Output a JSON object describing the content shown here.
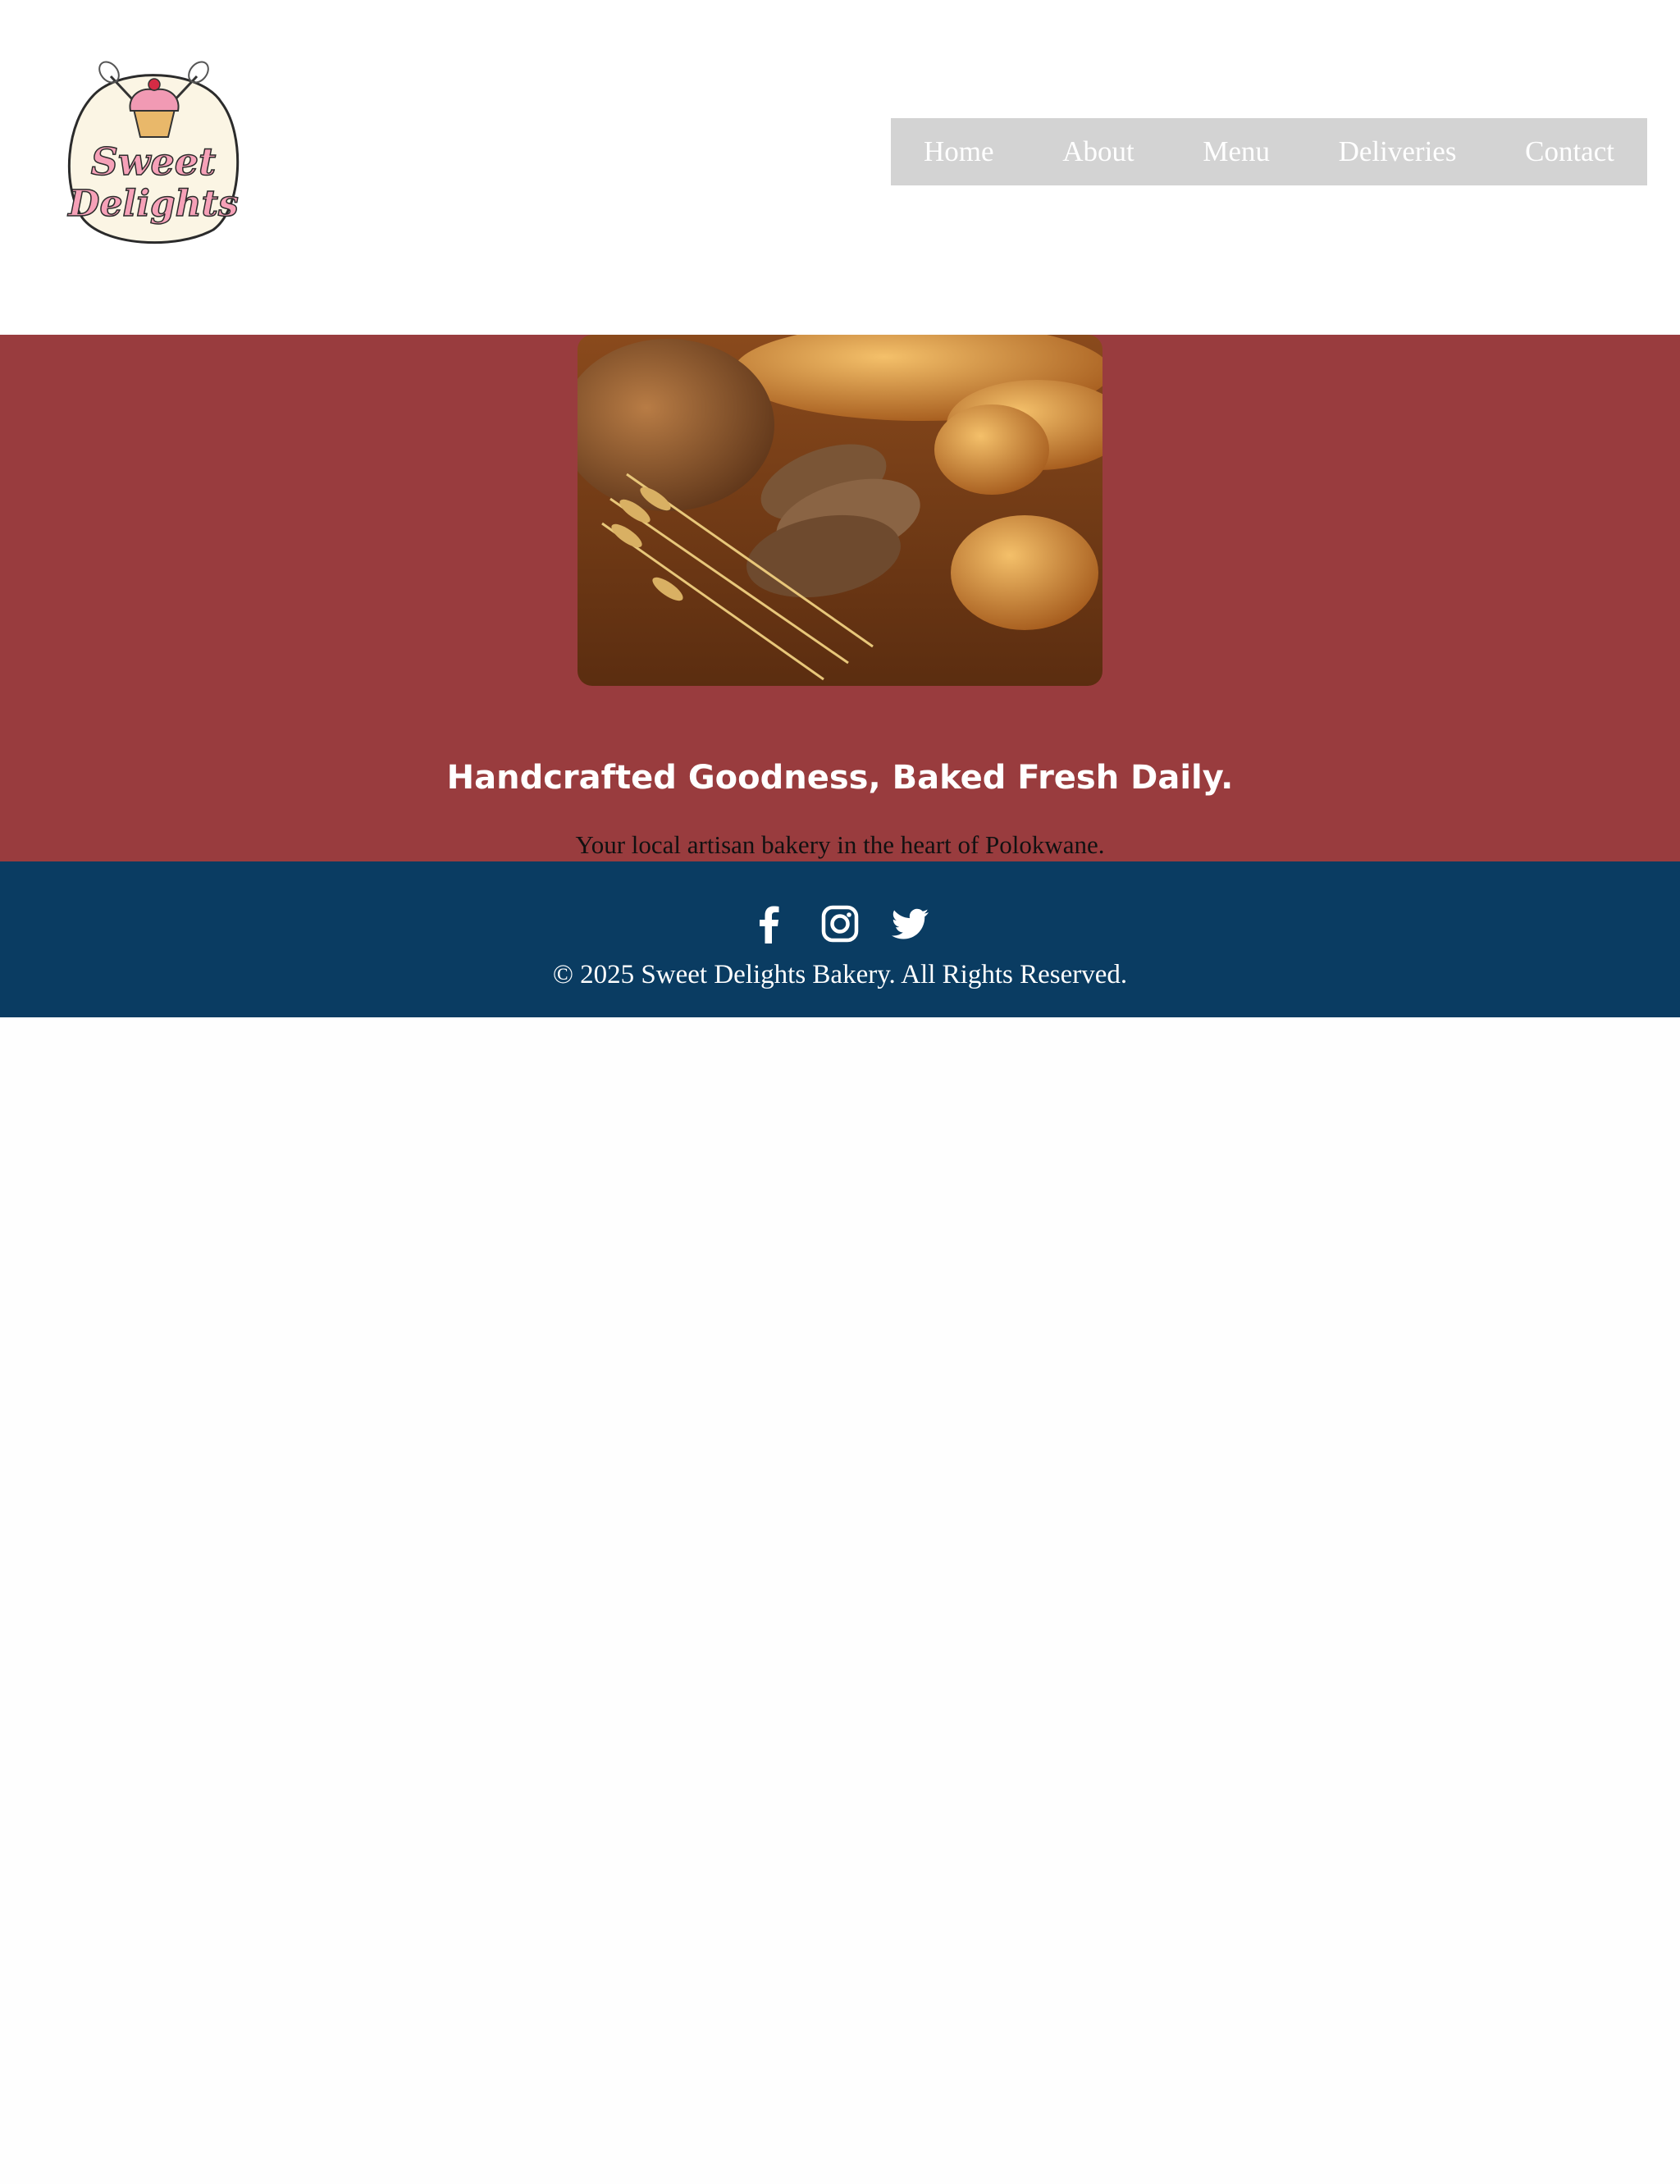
{
  "logo": {
    "line1": "Sweet",
    "line2": "Delights"
  },
  "nav": {
    "items": [
      {
        "label": "Home"
      },
      {
        "label": "About"
      },
      {
        "label": "Menu"
      },
      {
        "label": "Deliveries"
      },
      {
        "label": "Contact"
      }
    ]
  },
  "hero": {
    "title": "Handcrafted Goodness, Baked Fresh Daily.",
    "subtitle": "Your local artisan bakery in the heart of Polokwane."
  },
  "footer": {
    "social_icons": [
      "facebook-icon",
      "instagram-icon",
      "twitter-icon"
    ],
    "copyright": "© 2025 Sweet Delights Bakery. All Rights Reserved."
  },
  "colors": {
    "hero_bg": "#993c3e",
    "footer_bg": "#0a3c62",
    "nav_bg": "#d3d3d3"
  }
}
